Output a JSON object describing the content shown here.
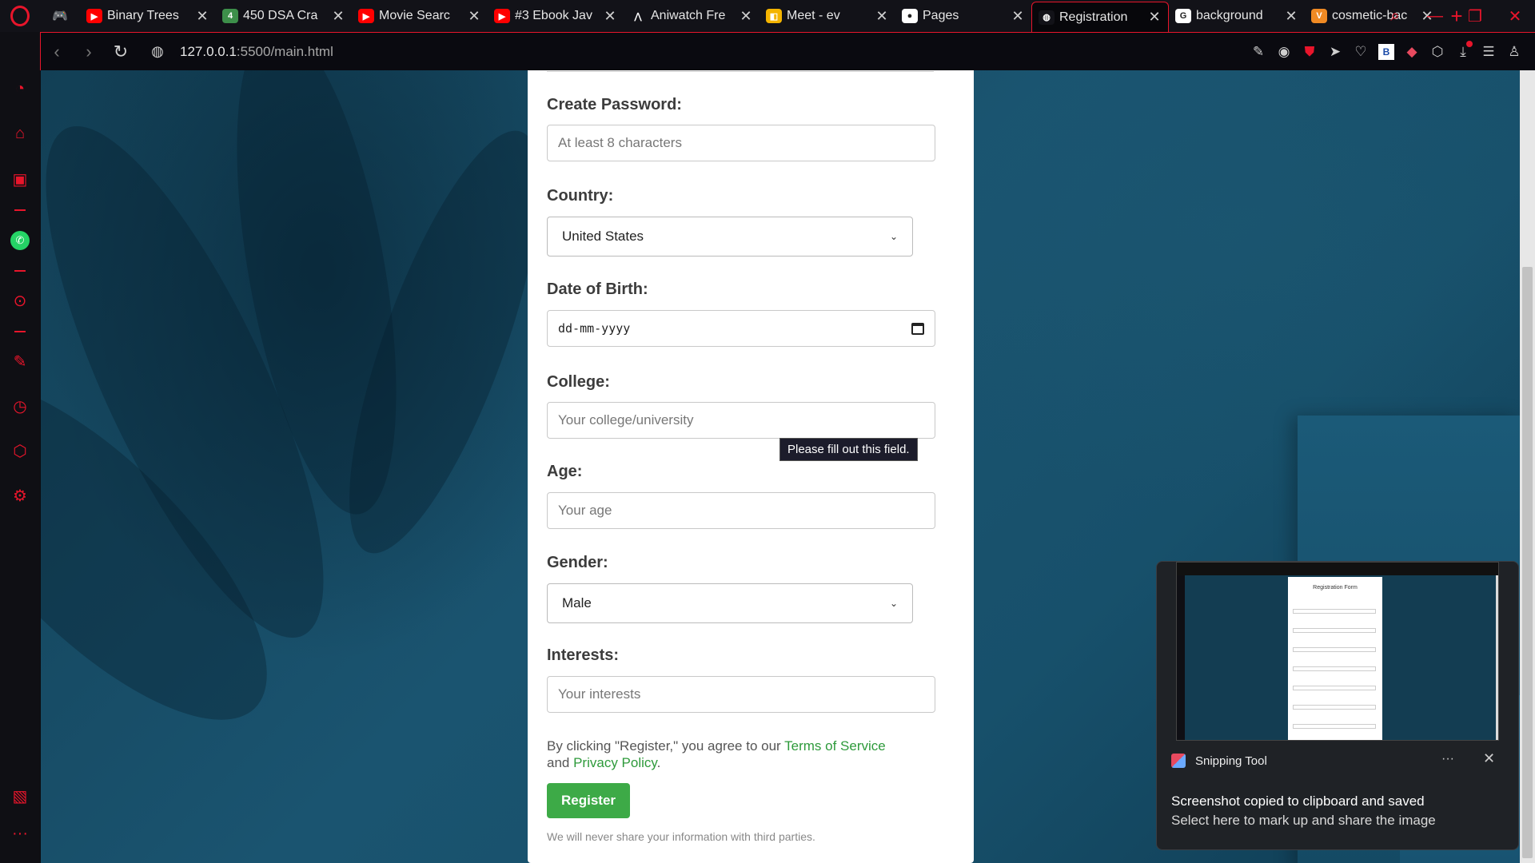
{
  "browser": {
    "tabs": [
      {
        "title": "Binary Trees",
        "favicon": "youtube-icon",
        "color": "#ff0000",
        "glyph": "▶"
      },
      {
        "title": "450 DSA Cra",
        "favicon": "sheets-icon",
        "color": "#3d8f4a",
        "glyph": "4"
      },
      {
        "title": "Movie Searc",
        "favicon": "youtube-icon",
        "color": "#ff0000",
        "glyph": "▶"
      },
      {
        "title": "#3 Ebook Jav",
        "favicon": "youtube-icon",
        "color": "#ff0000",
        "glyph": "▶"
      },
      {
        "title": "Aniwatch Fre",
        "favicon": "aniwatch-icon",
        "color": "#121218",
        "glyph": "⋀"
      },
      {
        "title": "Meet - ev",
        "favicon": "meet-icon",
        "color": "#f4b400",
        "glyph": "◧"
      },
      {
        "title": "Pages",
        "favicon": "github-icon",
        "color": "#ffffff",
        "glyph": "●"
      },
      {
        "title": "Registration",
        "favicon": "globe-icon",
        "color": "#121218",
        "glyph": "◍"
      },
      {
        "title": "background",
        "favicon": "google-icon",
        "color": "#ffffff",
        "glyph": "G"
      },
      {
        "title": "cosmetic-bac",
        "favicon": "vecteezy-icon",
        "color": "#f08a24",
        "glyph": "V"
      }
    ],
    "address": {
      "host": "127.0.0.1",
      "rest": ":5500/main.html"
    },
    "accent": "#e8152b"
  },
  "form": {
    "password_label": "Create Password:",
    "password_placeholder": "At least 8 characters",
    "country_label": "Country:",
    "country_value": "United States",
    "dob_label": "Date of Birth:",
    "dob_placeholder": "dd-mm-yyyy",
    "college_label": "College:",
    "college_placeholder": "Your college/university",
    "validation_tooltip": "Please fill out this field.",
    "age_label": "Age:",
    "age_placeholder": "Your age",
    "gender_label": "Gender:",
    "gender_value": "Male",
    "interests_label": "Interests:",
    "interests_placeholder": "Your interests",
    "terms_prefix": "By clicking \"Register,\" you agree to our ",
    "terms_link": "Terms of Service",
    "terms_mid": "and ",
    "privacy_link": "Privacy Policy",
    "terms_suffix": ".",
    "register_label": "Register",
    "privacy_note": "We will never share your information with third parties.",
    "button_color": "#3daa47"
  },
  "notification": {
    "app_name": "Snipping Tool",
    "more_label": "···",
    "close_label": "✕",
    "line1": "Screenshot copied to clipboard and saved",
    "line2": "Select here to mark up and share the image",
    "preview_title": "Registration Form"
  }
}
